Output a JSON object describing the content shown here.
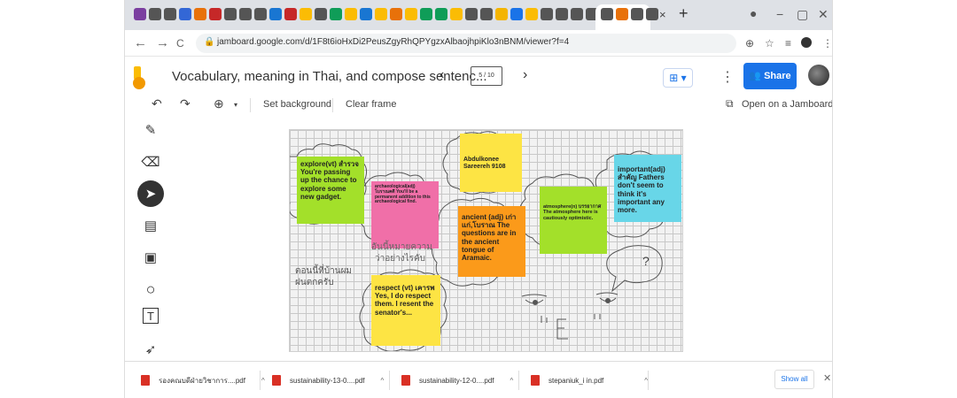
{
  "browser": {
    "tab_close": "×",
    "new_tab": "+",
    "window_minimize": "−",
    "window_maximize": "▢",
    "window_close": "✕",
    "favicon_colors": [
      "#7b3fa0",
      "#555",
      "#555",
      "#3367d6",
      "#e8710a",
      "#c62828",
      "#555",
      "#555",
      "#555",
      "#1976d2",
      "#c62828",
      "#fbbc04",
      "#555",
      "#0f9d58",
      "#fbbc04",
      "#1976d2",
      "#fbbc04",
      "#e8710a",
      "#fbbc04",
      "#0f9d58",
      "#0f9d58",
      "#fbbc04",
      "#555",
      "#555",
      "#f4b400",
      "#1a73e8",
      "#fbbc04",
      "#555",
      "#555",
      "#555",
      "#555",
      "#555",
      "#e8710a",
      "#555",
      "#555"
    ],
    "url": "jamboard.google.com/d/1F8t6ioHxDi2PeusZgyRhQPYgzxAlbaojhpiKlo3nBNM/viewer?f=4",
    "nav_back": "←",
    "nav_forward": "→",
    "reload": "C",
    "lock_icon": "🔒"
  },
  "header": {
    "title": "Vocabulary, meaning in Thai, and compose sentenc...",
    "prev": "‹",
    "next": "›",
    "frame_indicator": "5 / 10",
    "share_label": "Share",
    "kebab": "⋮",
    "add_frame": "⊞ ▾"
  },
  "toolbar": {
    "undo": "↶",
    "redo": "↷",
    "zoom_icon": "⊕",
    "zoom_caret": "▾",
    "set_background": "Set background",
    "clear_frame": "Clear frame",
    "open_on_jamboard": "Open on a Jamboard"
  },
  "tools": {
    "pen": "✎",
    "eraser": "⌫",
    "select": "➤",
    "sticky_note": "▤",
    "image": "▣",
    "circle": "○",
    "text_box": "T",
    "laser": "➶"
  },
  "board": {
    "notes": [
      {
        "text": "explore(vt) สำรวจ You're passing up the chance to explore some new gadget.",
        "color": "#a3e02a"
      },
      {
        "text": "archaeological(adj) โบราณคดี You'll be a permanent addition to this archaeological find.",
        "color": "#f06fa8"
      },
      {
        "text": "Abdulkonee Sareereh 9108",
        "color": "#fde444"
      },
      {
        "text": "ancient (adj) เก่าแก่,โบราณ The questions are in the ancient tongue of Aramaic.",
        "color": "#fb9a1a"
      },
      {
        "text": "atmosphere(n) บรรยากาศ The atmosphere here is cautiously optimistic.",
        "color": "#a3e02a"
      },
      {
        "text": "important(adj) สำคัญ Fathers don't seem to think it's important any more.",
        "color": "#68d6e8"
      },
      {
        "text": "respect  (vt) เคารพ Yes, I do respect them. I resent the senator's...",
        "color": "#fde444"
      }
    ],
    "handwriting": [
      "อันนี้หมายความ",
      "ว่าอย่างไรคับ",
      "ตอนนี้ที่บ้านผม",
      "ฝนตกครับ",
      "?"
    ]
  },
  "downloads": {
    "items": [
      {
        "name": "รองคณบดีฝ่ายวิชาการ....pdf"
      },
      {
        "name": "sustainability-13-0....pdf"
      },
      {
        "name": "sustainability-12-0....pdf"
      },
      {
        "name": "stepaniuk_i in.pdf"
      }
    ],
    "caret": "^",
    "show_all": "Show all",
    "close": "✕"
  }
}
